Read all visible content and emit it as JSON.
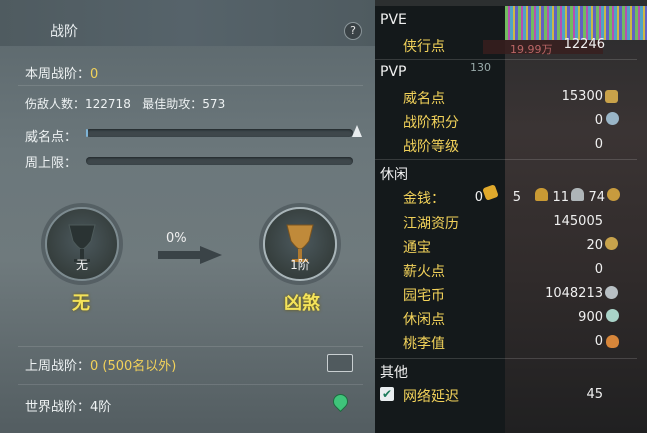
{
  "left": {
    "tab_title": "战阶",
    "help": "?",
    "weekly_rank_label": "本周战阶：",
    "weekly_rank_value": "0",
    "wounded_label": "伤敌人数：",
    "wounded_value": "122718",
    "best_assist_label": "最佳助攻：",
    "best_assist_value": "573",
    "prestige_label": "威名点：",
    "prestige_progress": 0.0,
    "weekly_cap_label": "周上限：",
    "weekly_cap_progress": 0.0,
    "current_rank": {
      "level": "无",
      "name": "无"
    },
    "progress_pct": "0%",
    "next_rank": {
      "level": "1阶",
      "name": "凶煞"
    },
    "last_week_label": "上周战阶：",
    "last_week_value": "0 (500名以外)",
    "world_rank_label": "世界战阶：",
    "world_rank_value": "4阶"
  },
  "right": {
    "pve": {
      "title": "PVE",
      "rows": [
        {
          "label": "侠行点",
          "value": "12246"
        }
      ]
    },
    "pvp": {
      "title": "PVP",
      "rows": [
        {
          "label": "威名点",
          "value": "15300"
        },
        {
          "label": "战阶积分",
          "value": "0"
        },
        {
          "label": "战阶等级",
          "value": "0"
        }
      ]
    },
    "leisure": {
      "title": "休闲",
      "money": {
        "label": "金钱：",
        "gold": "0",
        "silver": "5",
        "copper1": "11",
        "copper2": "74"
      },
      "rows": [
        {
          "label": "江湖资历",
          "value": "145005"
        },
        {
          "label": "通宝",
          "value": "20"
        },
        {
          "label": "薪火点",
          "value": "0"
        },
        {
          "label": "园宅币",
          "value": "1048213"
        },
        {
          "label": "休闲点",
          "value": "900"
        },
        {
          "label": "桃李值",
          "value": "0"
        }
      ]
    },
    "other": {
      "title": "其他",
      "rows": [
        {
          "label": "网络延迟",
          "value": "45"
        }
      ]
    },
    "bg_text": {
      "hp": "19.99万",
      "lvl": "130"
    }
  },
  "colors": {
    "accent_yellow": "#f2d25a",
    "rank_name": "#f4e35a",
    "pin": "#3fc47a"
  }
}
